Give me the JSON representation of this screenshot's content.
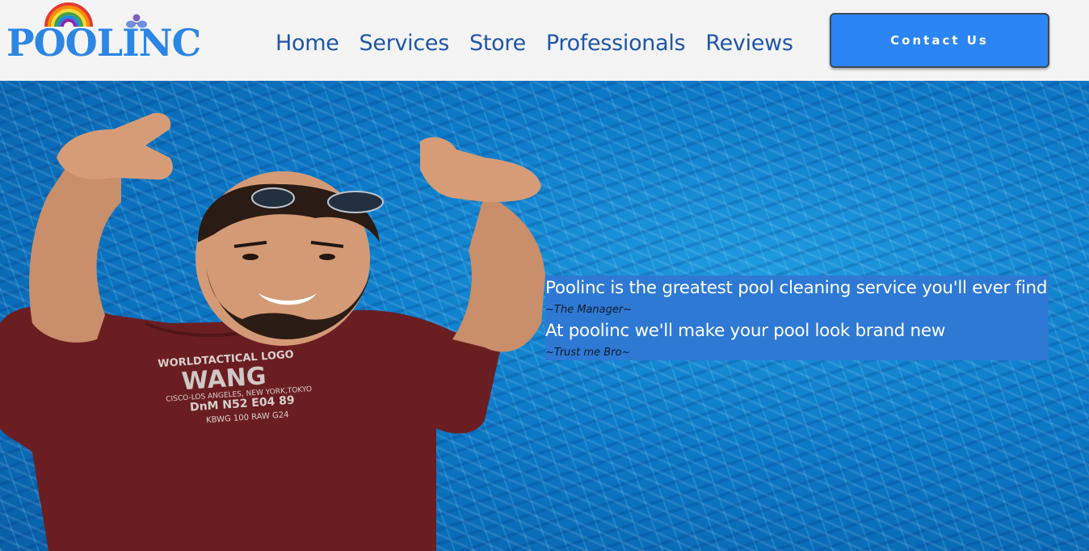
{
  "brand": {
    "name": "POOLINC",
    "color": "#2b86e5"
  },
  "nav": {
    "items": [
      "Home",
      "Services",
      "Store",
      "Professionals",
      "Reviews"
    ],
    "color": "#1f56a8"
  },
  "cta": {
    "label": "Contact Us",
    "color": "#2b85f3"
  },
  "hero": {
    "quote1": "Poolinc is the greatest pool cleaning service you'll ever find",
    "sign1": "~The Manager~",
    "quote2": "At poolinc we'll make your pool look brand new",
    "sign2": "~Trust me Bro~",
    "panel_color": "#2e79d4",
    "shirt_lines": [
      "WORLDTACTICAL LOGO",
      "WANG",
      "CISCO-LOS ANGELES, NEW YORK,TOKYO",
      "DnM N52 E04 89",
      "KBWG 100 RAW G24"
    ]
  }
}
